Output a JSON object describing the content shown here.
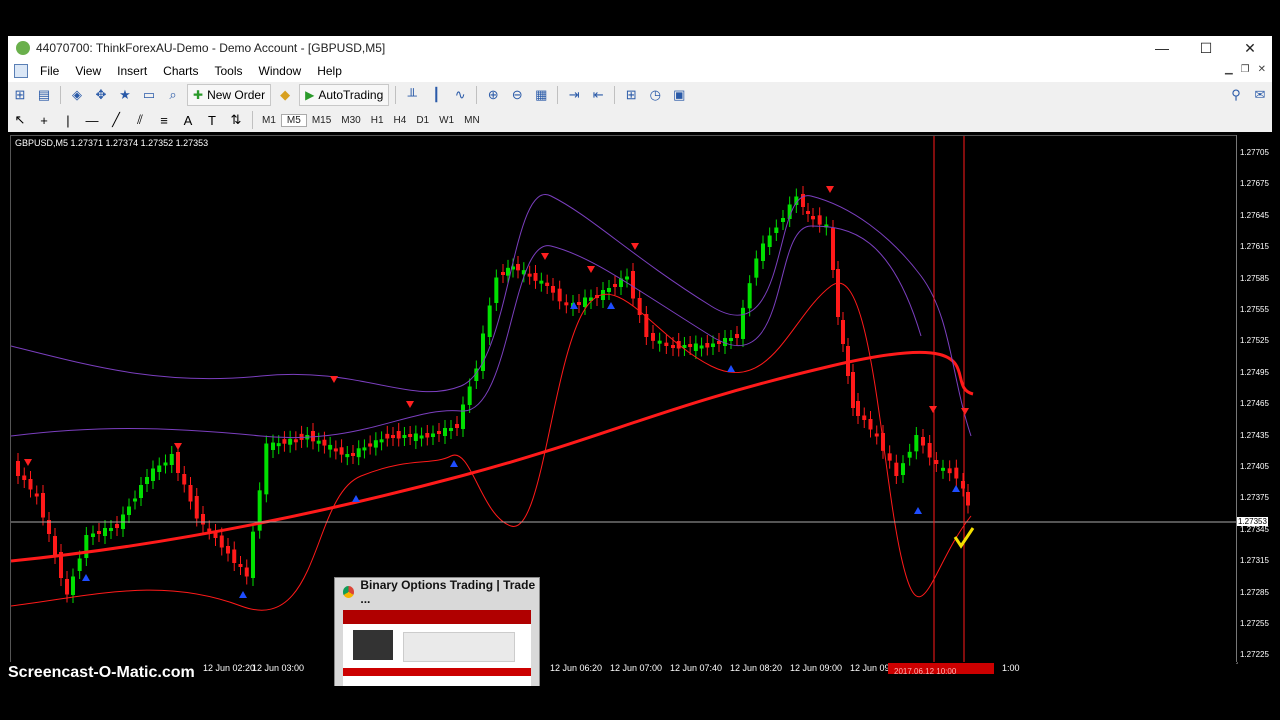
{
  "window": {
    "title": "44070700: ThinkForexAU-Demo - Demo Account - [GBPUSD,M5]",
    "minimize": "—",
    "maximize": "☐",
    "close": "✕"
  },
  "menu": [
    "File",
    "View",
    "Insert",
    "Charts",
    "Tools",
    "Window",
    "Help"
  ],
  "toolbar": {
    "new_order": "New Order",
    "autotrading": "AutoTrading"
  },
  "timeframes": [
    "M1",
    "M5",
    "M15",
    "M30",
    "H1",
    "H4",
    "D1",
    "W1",
    "MN"
  ],
  "chart": {
    "symbol_info": "GBPUSD,M5  1.27371 1.27374 1.27352 1.27353",
    "price_labels": [
      "1.27705",
      "1.27675",
      "1.27645",
      "1.27615",
      "1.27585",
      "1.27555",
      "1.27525",
      "1.27495",
      "1.27465",
      "1.27435",
      "1.27405",
      "1.27375",
      "1.27345",
      "1.27315",
      "1.27285",
      "1.27255",
      "1.27225"
    ],
    "current_price": "1.27353",
    "time_labels": [
      "12 Jun 02:20",
      "12 Jun 03:00",
      "12 Jun 06:20",
      "12 Jun 07:00",
      "12 Jun 07:40",
      "12 Jun 08:20",
      "12 Jun 09:00",
      "12 Jun 09:4"
    ],
    "highlighted_time": "2017.06.12 10:00",
    "time_tail": "1:00",
    "colors": {
      "bull": "#00e000",
      "bear": "#ff1a1a",
      "ma": "#ff1a1a",
      "band": "#7b3fbf",
      "up_arrow": "#1e4dff",
      "down_arrow": "#ff2020",
      "check": "#f5e000"
    }
  },
  "popup": {
    "title": "Binary Options Trading | Trade ..."
  },
  "watermark": "Screencast-O-Matic.com"
}
